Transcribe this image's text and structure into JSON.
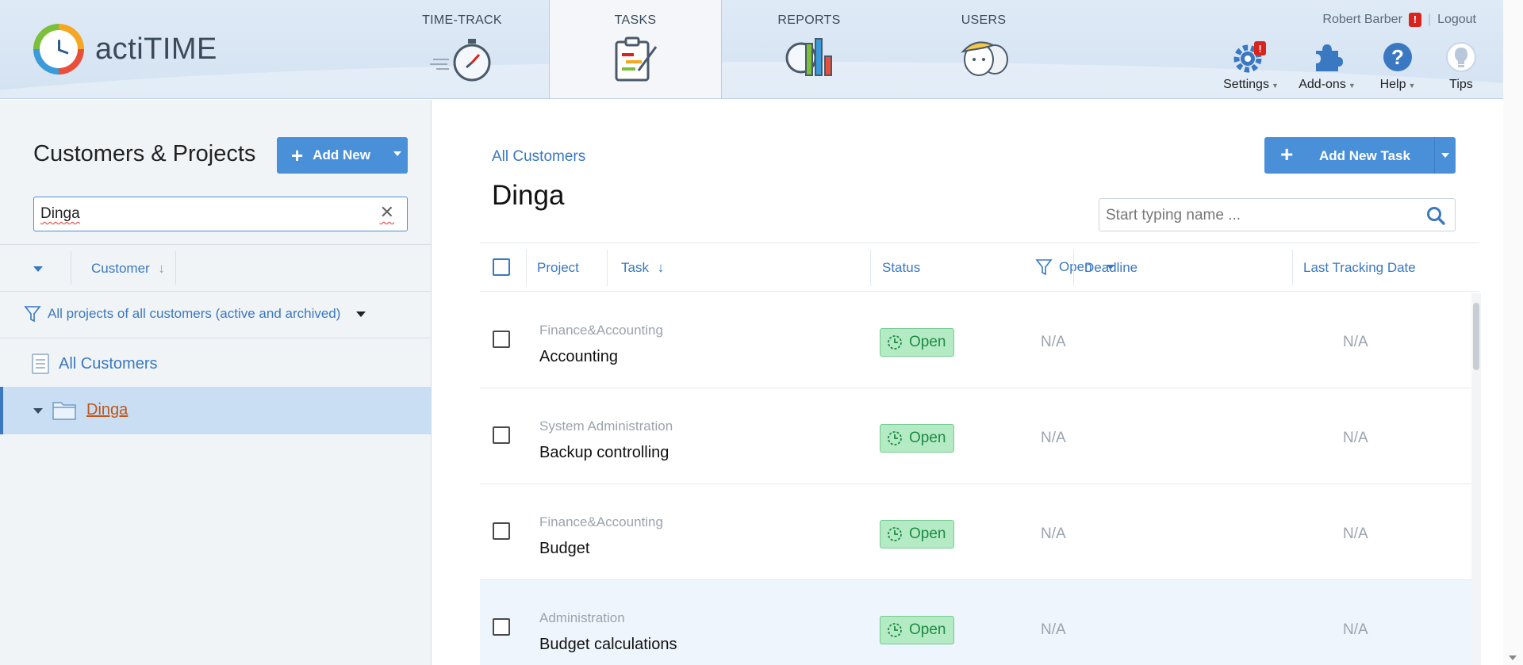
{
  "app": {
    "name": "actiTIME"
  },
  "nav": {
    "tabs": [
      {
        "label": "TIME-TRACK",
        "icon": "stopwatch-icon"
      },
      {
        "label": "TASKS",
        "icon": "clipboard-tasks-icon",
        "active": true
      },
      {
        "label": "REPORTS",
        "icon": "chart-icon"
      },
      {
        "label": "USERS",
        "icon": "users-icon"
      }
    ]
  },
  "user": {
    "name": "Robert Barber",
    "warning": "!",
    "separator": "|",
    "logout": "Logout"
  },
  "tools": {
    "settings": {
      "label": "Settings",
      "icon": "gear-icon",
      "badge": "!"
    },
    "addons": {
      "label": "Add-ons",
      "icon": "puzzle-icon"
    },
    "help": {
      "label": "Help",
      "icon": "question-icon"
    },
    "tips": {
      "label": "Tips",
      "icon": "lightbulb-icon"
    }
  },
  "left": {
    "title": "Customers & Projects",
    "add_new": "Add New",
    "search_value": "Dinga",
    "sort_label": "Customer",
    "filter_label": "All projects of all customers (active and archived)",
    "all_customers": "All Customers",
    "selected_customer": "Dinga"
  },
  "main": {
    "breadcrumb": "All Customers",
    "title": "Dinga",
    "add_task": "Add New Task",
    "search_placeholder": "Start typing name ...",
    "columns": {
      "project": "Project",
      "task": "Task",
      "status": "Status",
      "status_filter": "Open",
      "deadline": "Deadline",
      "last_tracking": "Last Tracking Date"
    },
    "rows": [
      {
        "project": "Finance&Accounting",
        "task": "Accounting",
        "status": "Open",
        "deadline": "N/A",
        "last_tracking": "N/A"
      },
      {
        "project": "System Administration",
        "task": "Backup controlling",
        "status": "Open",
        "deadline": "N/A",
        "last_tracking": "N/A"
      },
      {
        "project": "Finance&Accounting",
        "task": "Budget",
        "status": "Open",
        "deadline": "N/A",
        "last_tracking": "N/A"
      },
      {
        "project": "Administration",
        "task": "Budget calculations",
        "status": "Open",
        "deadline": "N/A",
        "last_tracking": "N/A"
      }
    ]
  },
  "colors": {
    "accent": "#4a90d9",
    "link": "#3a78c2",
    "status_open_bg": "#b4ebc4",
    "status_open_text": "#1e8a44",
    "selected_row": "#c9ddf3"
  }
}
